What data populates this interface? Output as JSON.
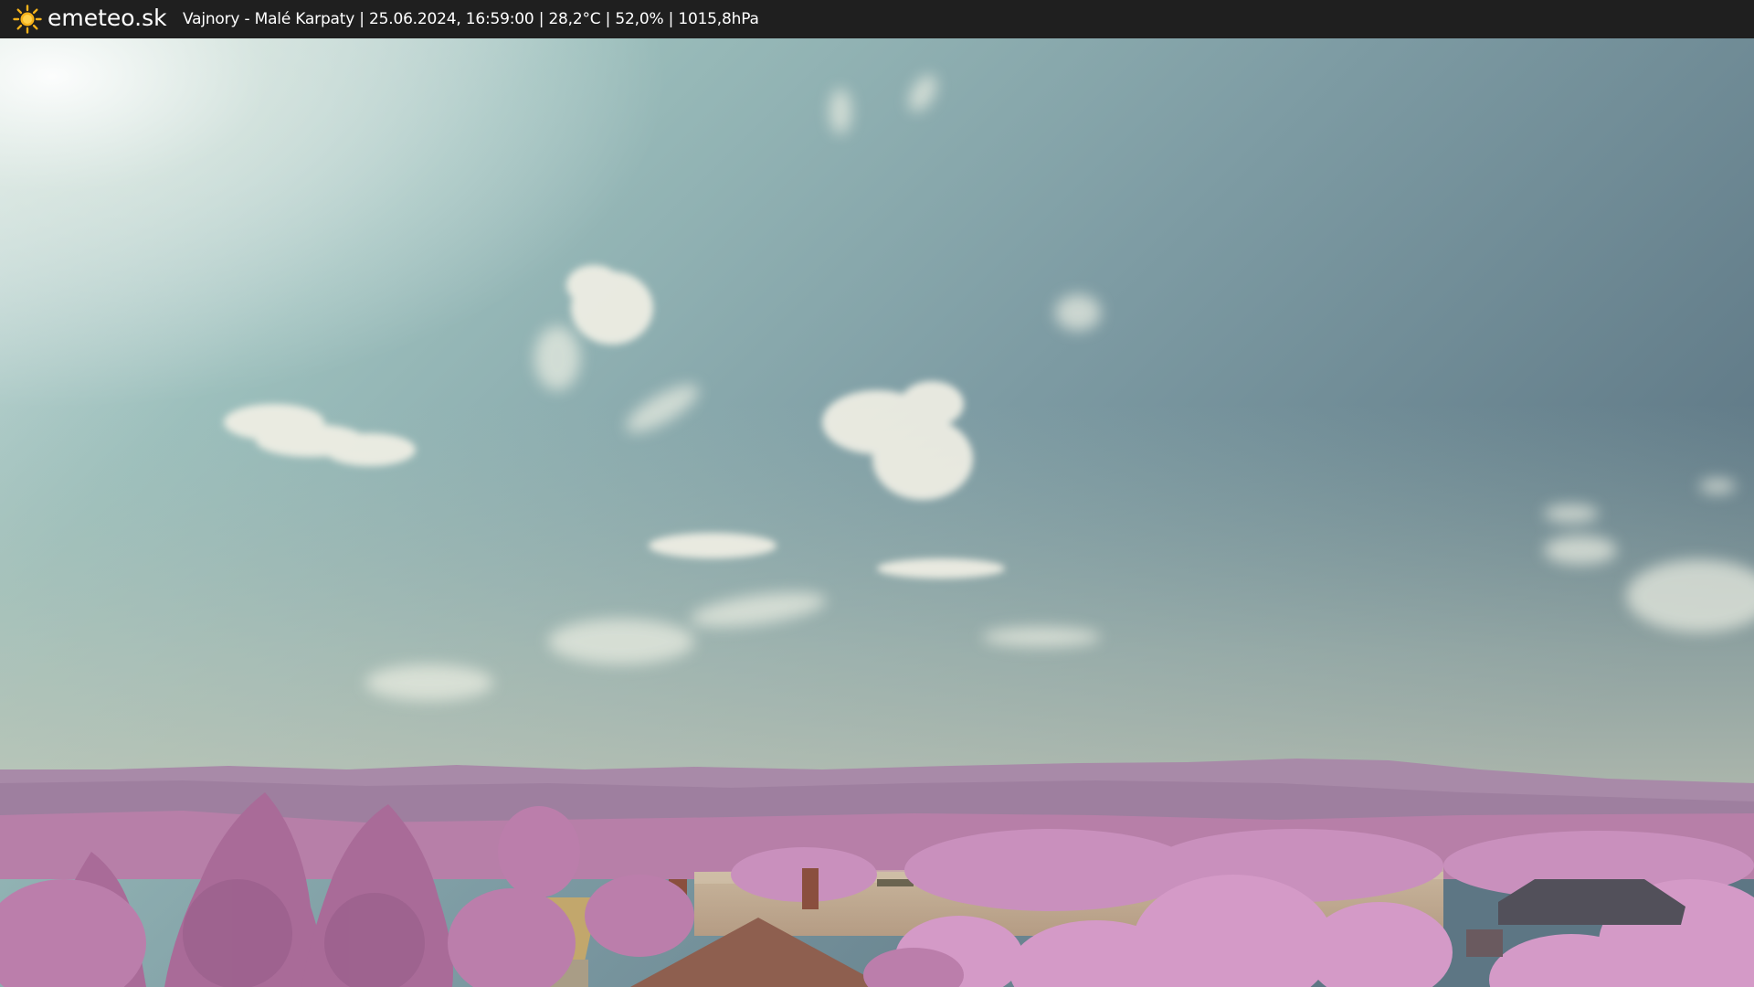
{
  "header": {
    "brand": "emeteo.sk",
    "logo_icon": "sun-icon",
    "status_text": "Vajnory - Malé Karpaty | 25.06.2024, 16:59:00 | 28,2°C | 52,0% | 1015,8hPa"
  },
  "colors": {
    "bar_background": "#1f1f1f",
    "text": "#ffffff",
    "sun_logo": "#f5b21a"
  }
}
